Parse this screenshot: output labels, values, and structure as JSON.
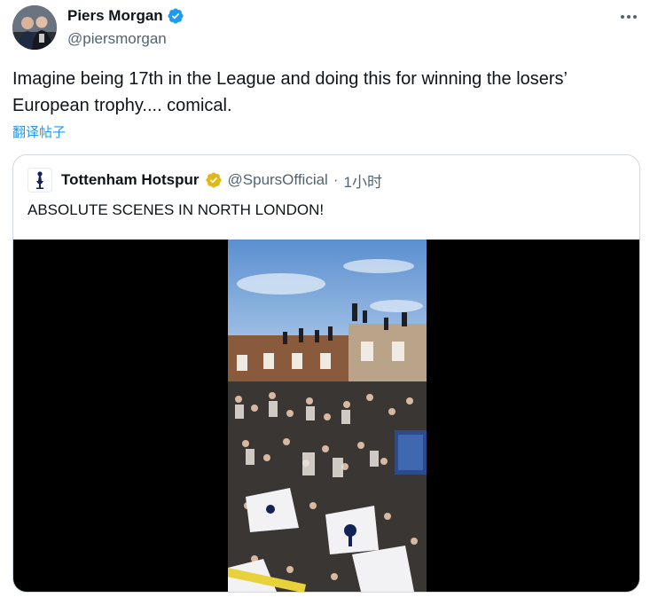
{
  "author": {
    "name": "Piers Morgan",
    "handle": "@piersmorgan",
    "verified_icon": "verified-badge-icon",
    "avatar_icon": "avatar"
  },
  "tweet": {
    "text": "Imagine being 17th in the League and doing this for winning the losers’ European trophy.... comical.",
    "translate_label": "翻译帖子"
  },
  "quoted": {
    "name": "Tottenham Hotspur",
    "handle": "@SpursOfficial",
    "separator": "·",
    "time": "1小时",
    "text": "ABSOLUTE SCENES IN NORTH LONDON!",
    "badge_icon": "gold-verified-badge-icon",
    "avatar_icon": "cockerel-logo-icon"
  },
  "colors": {
    "link": "#1d9bf0",
    "secondary_text": "#536471",
    "border": "#cfd9de",
    "verified_blue": "#1d9bf0",
    "verified_gold": "#e2b719"
  }
}
